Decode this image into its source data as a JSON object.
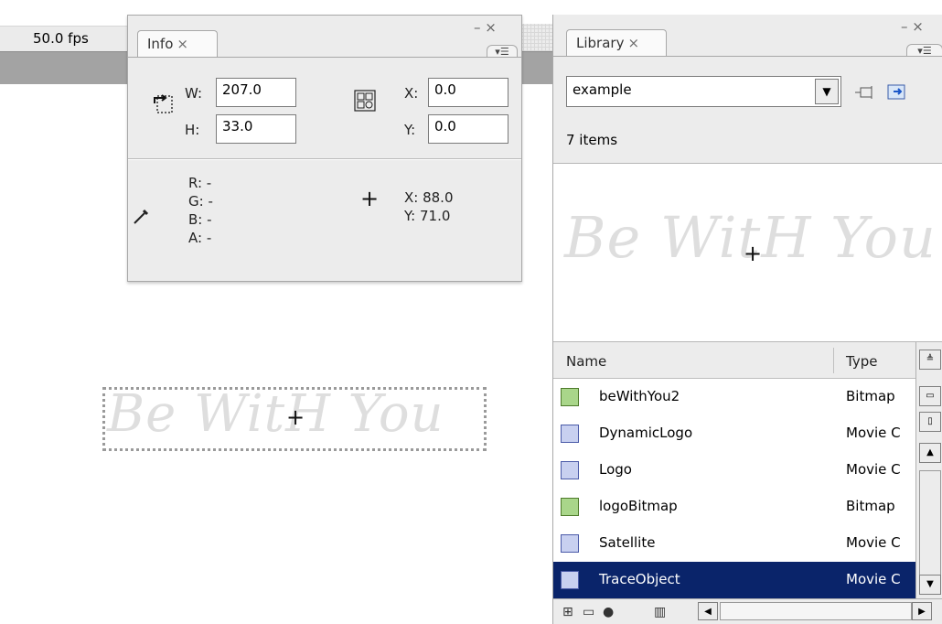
{
  "timeline": {
    "fps": "50.0 fps"
  },
  "info_panel": {
    "tab_label": "Info",
    "close_glyph": "×",
    "window_controls": "– ×",
    "menu_glyph": "▾☰",
    "w_label": "W:",
    "w_value": "207.0",
    "h_label": "H:",
    "h_value": "33.0",
    "x_label": "X:",
    "x_value": "0.0",
    "y_label": "Y:",
    "y_value": "0.0",
    "r_label": "R: -",
    "g_label": "G: -",
    "b_label": "B: -",
    "a_label": "A: -",
    "cursor_x": "X: 88.0",
    "cursor_y": "Y: 71.0",
    "crosshair": "+"
  },
  "stage": {
    "logo_text": "Be WitH You",
    "crosshair": "+"
  },
  "library_panel": {
    "tab_label": "Library",
    "close_glyph": "×",
    "window_controls": "– ×",
    "menu_glyph": "▾☰",
    "document_select": "example",
    "item_count": "7 items",
    "preview_text": "Be WitH You",
    "preview_crosshair": "+",
    "columns": {
      "name": "Name",
      "type": "Type"
    },
    "items": [
      {
        "name": "beWithYou2",
        "type": "Bitmap",
        "icon": "bitmap-icon"
      },
      {
        "name": "DynamicLogo",
        "type": "Movie C",
        "icon": "movieclip-icon"
      },
      {
        "name": "Logo",
        "type": "Movie C",
        "icon": "movieclip-icon"
      },
      {
        "name": "logoBitmap",
        "type": "Bitmap",
        "icon": "bitmap-icon"
      },
      {
        "name": "Satellite",
        "type": "Movie C",
        "icon": "movieclip-icon"
      },
      {
        "name": "TraceObject",
        "type": "Movie C",
        "icon": "movieclip-icon",
        "selected": true
      }
    ]
  }
}
